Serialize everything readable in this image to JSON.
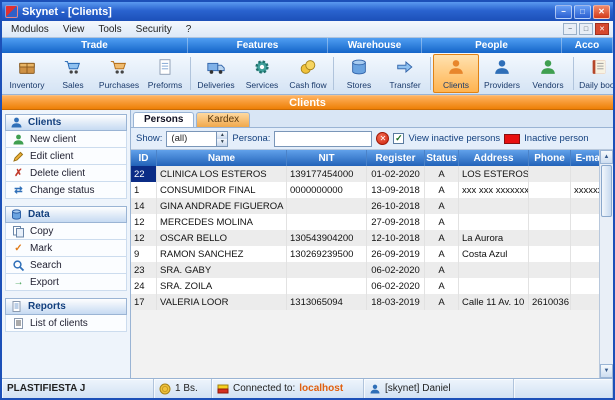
{
  "window": {
    "title": "Skynet - [Clients]"
  },
  "menu": {
    "items": [
      "Modulos",
      "View",
      "Tools",
      "Security",
      "?"
    ]
  },
  "ribbon": {
    "categories": [
      "Trade",
      "Features",
      "Warehouse",
      "People",
      "Acco"
    ],
    "buttons": [
      {
        "label": "Inventory",
        "icon": "inventory-icon"
      },
      {
        "label": "Sales",
        "icon": "sales-icon"
      },
      {
        "label": "Purchases",
        "icon": "purchases-icon"
      },
      {
        "label": "Preforms",
        "icon": "preforms-icon"
      },
      {
        "label": "Deliveries",
        "icon": "deliveries-icon"
      },
      {
        "label": "Services",
        "icon": "services-icon"
      },
      {
        "label": "Cash flow",
        "icon": "cashflow-icon"
      },
      {
        "label": "Stores",
        "icon": "stores-icon"
      },
      {
        "label": "Transfer",
        "icon": "transfer-icon"
      },
      {
        "label": "Clients",
        "icon": "clients-icon",
        "active": true
      },
      {
        "label": "Providers",
        "icon": "providers-icon"
      },
      {
        "label": "Vendors",
        "icon": "vendors-icon"
      },
      {
        "label": "Daily book",
        "icon": "dailybook-icon"
      }
    ]
  },
  "page": {
    "title": "Clients"
  },
  "sidebar": {
    "sections": [
      {
        "title": "Clients",
        "items": [
          "New client",
          "Edit client",
          "Delete client",
          "Change status"
        ]
      },
      {
        "title": "Data",
        "items": [
          "Copy",
          "Mark",
          "Search",
          "Export"
        ]
      },
      {
        "title": "Reports",
        "items": [
          "List of clients"
        ]
      }
    ]
  },
  "main": {
    "tabs": [
      "Persons",
      "Kardex"
    ],
    "filters": {
      "show_label": "Show:",
      "show_value": "(all)",
      "persona_label": "Persona:",
      "persona_value": "",
      "view_inactive_checked": true,
      "view_inactive_label": "View inactive persons",
      "inactive_legend_label": "Inactive person",
      "inactive_color": "#e81010"
    },
    "table": {
      "columns": [
        "ID",
        "Name",
        "NIT",
        "Register",
        "Status",
        "Address",
        "Phone",
        "E-mail"
      ],
      "selection": {
        "row": 0,
        "column": 0
      },
      "rows": [
        [
          "22",
          "CLINICA LOS ESTEROS",
          "139177454000",
          "01-02-2020",
          "A",
          "LOS ESTEROS",
          "",
          ""
        ],
        [
          "1",
          "CONSUMIDOR FINAL",
          "0000000000",
          "13-09-2018",
          "A",
          "xxx xxx xxxxxxx",
          "",
          "xxxxxxxxxxxxx xxxx"
        ],
        [
          "14",
          "GINA ANDRADE FIGUEROA",
          "",
          "26-10-2018",
          "A",
          "",
          "",
          ""
        ],
        [
          "12",
          "MERCEDES MOLINA",
          "",
          "27-09-2018",
          "A",
          "",
          "",
          ""
        ],
        [
          "12",
          "OSCAR BELLO",
          "130543904200",
          "12-10-2018",
          "A",
          "La Aurora",
          "",
          ""
        ],
        [
          "9",
          "RAMON SANCHEZ",
          "130269239500",
          "26-09-2019",
          "A",
          "Costa Azul",
          "",
          ""
        ],
        [
          "23",
          "SRA. GABY",
          "",
          "06-02-2020",
          "A",
          "",
          "",
          ""
        ],
        [
          "24",
          "SRA. ZOILA",
          "",
          "06-02-2020",
          "A",
          "",
          "",
          ""
        ],
        [
          "17",
          "VALERIA LOOR",
          "1313065094",
          "18-03-2019",
          "A",
          "Calle 11 Av. 10",
          "2610036",
          ""
        ]
      ]
    }
  },
  "statusbar": {
    "company": "PLASTIFIESTA J",
    "balance": "1 Bs.",
    "connection_label": "Connected to:",
    "connection_value": "localhost",
    "user": "[skynet] Daniel"
  }
}
